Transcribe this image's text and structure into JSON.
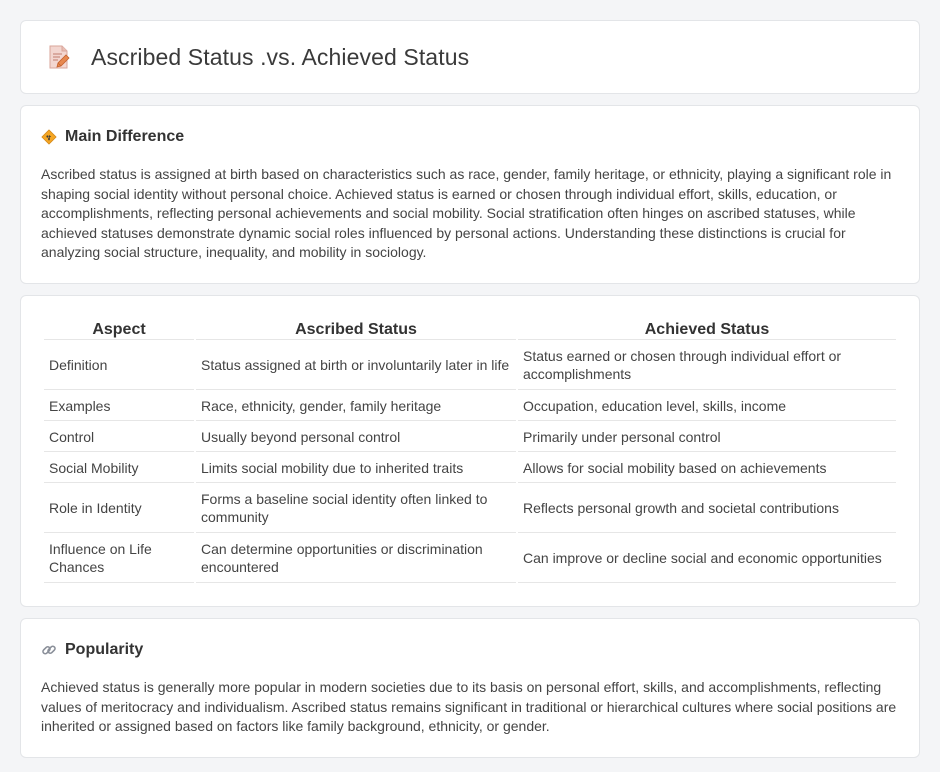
{
  "header": {
    "title": "Ascribed Status .vs. Achieved Status",
    "icon": "document-pencil-icon"
  },
  "main_difference": {
    "title": "Main Difference",
    "icon": "diamond-sign-icon",
    "text": "Ascribed status is assigned at birth based on characteristics such as race, gender, family heritage, or ethnicity, playing a significant role in shaping social identity without personal choice. Achieved status is earned or chosen through individual effort, skills, education, or accomplishments, reflecting personal achievements and social mobility. Social stratification often hinges on ascribed statuses, while achieved statuses demonstrate dynamic social roles influenced by personal actions. Understanding these distinctions is crucial for analyzing social structure, inequality, and mobility in sociology."
  },
  "comparison": {
    "columns": [
      "Aspect",
      "Ascribed Status",
      "Achieved Status"
    ],
    "rows": [
      {
        "aspect": "Definition",
        "ascribed": "Status assigned at birth or involuntarily later in life",
        "achieved": "Status earned or chosen through individual effort or accomplishments"
      },
      {
        "aspect": "Examples",
        "ascribed": "Race, ethnicity, gender, family heritage",
        "achieved": "Occupation, education level, skills, income"
      },
      {
        "aspect": "Control",
        "ascribed": "Usually beyond personal control",
        "achieved": "Primarily under personal control"
      },
      {
        "aspect": "Social Mobility",
        "ascribed": "Limits social mobility due to inherited traits",
        "achieved": "Allows for social mobility based on achievements"
      },
      {
        "aspect": "Role in Identity",
        "ascribed": "Forms a baseline social identity often linked to community",
        "achieved": "Reflects personal growth and societal contributions"
      },
      {
        "aspect": "Influence on Life Chances",
        "ascribed": "Can determine opportunities or discrimination encountered",
        "achieved": "Can improve or decline social and economic opportunities"
      }
    ]
  },
  "popularity": {
    "title": "Popularity",
    "icon": "link-icon",
    "text": "Achieved status is generally more popular in modern societies due to its basis on personal effort, skills, and accomplishments, reflecting values of meritocracy and individualism. Ascribed status remains significant in traditional or hierarchical cultures where social positions are inherited or assigned based on factors like family background, ethnicity, or gender."
  }
}
